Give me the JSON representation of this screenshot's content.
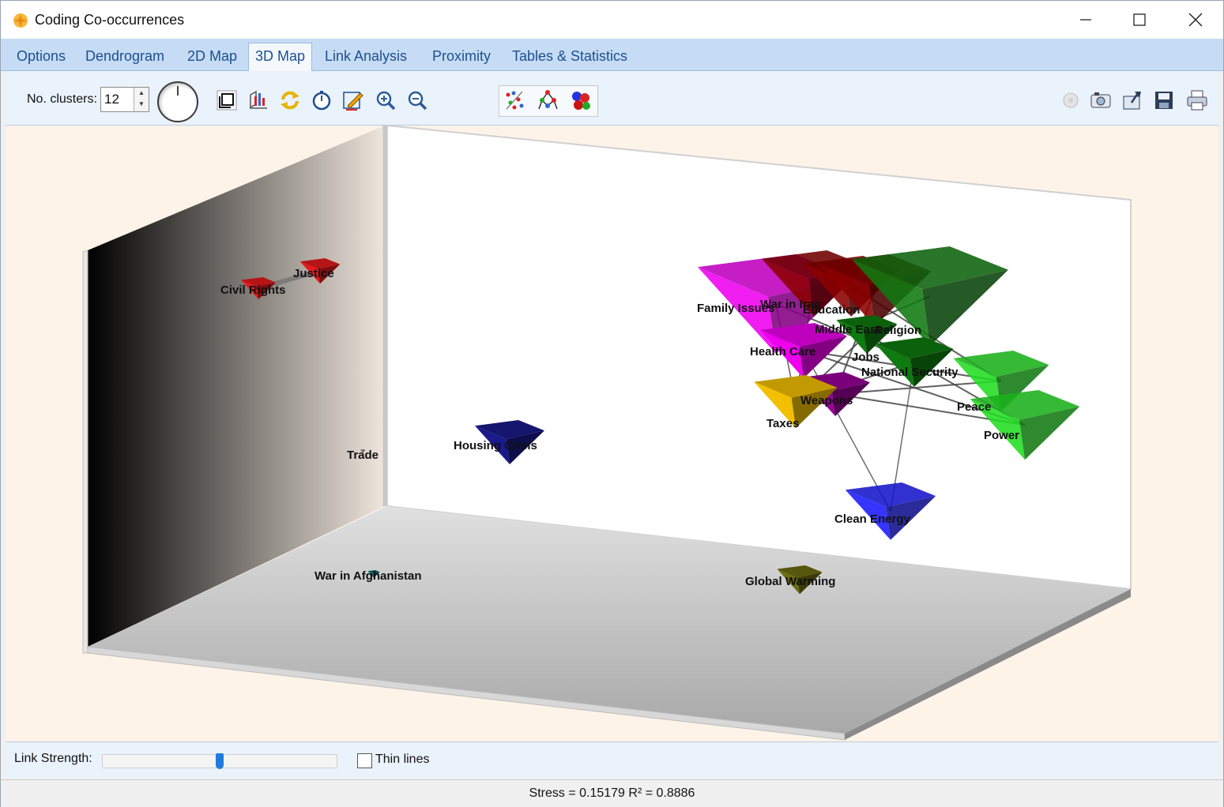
{
  "window": {
    "title": "Coding Co-occurrences",
    "controls": [
      "minimize",
      "maximize",
      "close"
    ]
  },
  "tabs": [
    {
      "label": "Options",
      "active": false
    },
    {
      "label": "Dendrogram",
      "active": false
    },
    {
      "label": "2D Map",
      "active": false
    },
    {
      "label": "3D Map",
      "active": true
    },
    {
      "label": "Link Analysis",
      "active": false
    },
    {
      "label": "Proximity",
      "active": false
    },
    {
      "label": "Tables & Statistics",
      "active": false
    }
  ],
  "toolbar": {
    "clusters_label": "No. clusters:",
    "clusters_value": "12",
    "icons": [
      "rotation-dial-icon",
      "box-frame-icon",
      "axes-icon",
      "refresh-icon",
      "timer-icon",
      "edit-icon",
      "zoom-in-icon",
      "zoom-out-icon",
      "points-view-icon",
      "links-view-icon",
      "clusters-view-icon",
      "record-icon",
      "camera-icon",
      "export-icon",
      "save-icon",
      "print-icon"
    ]
  },
  "map": {
    "nodes": [
      {
        "label": "Civil Rights",
        "color": "#e31a1c"
      },
      {
        "label": "Justice",
        "color": "#e31a1c"
      },
      {
        "label": "Trade",
        "color": "#888888"
      },
      {
        "label": "Housing Crisis",
        "color": "#1a1a8a"
      },
      {
        "label": "War in Afghanistan",
        "color": "#0f6a6a"
      },
      {
        "label": "Global Warming",
        "color": "#6b6b10"
      },
      {
        "label": "Clean Energy",
        "color": "#1a1aff"
      },
      {
        "label": "Family Issues",
        "color": "#ee00ee"
      },
      {
        "label": "War in Iraq",
        "color": "#8b0000"
      },
      {
        "label": "Education",
        "color": "#8b0000"
      },
      {
        "label": "Middle East",
        "color": "#8b0000"
      },
      {
        "label": "Religion",
        "color": "#0f7a0f"
      },
      {
        "label": "Health Care",
        "color": "#ee00ee"
      },
      {
        "label": "Jobs",
        "color": "#0f7a0f"
      },
      {
        "label": "National Security",
        "color": "#0f7a0f"
      },
      {
        "label": "Weapons",
        "color": "#990099"
      },
      {
        "label": "Taxes",
        "color": "#f2c000"
      },
      {
        "label": "Peace",
        "color": "#22dd22"
      },
      {
        "label": "Power",
        "color": "#22dd22"
      }
    ]
  },
  "bottom": {
    "link_strength_label": "Link Strength:",
    "link_strength_value": 0.5,
    "thin_lines_label": "Thin lines",
    "thin_lines_checked": false
  },
  "status": {
    "text": "Stress = 0.15179    R² = 0.8886"
  }
}
